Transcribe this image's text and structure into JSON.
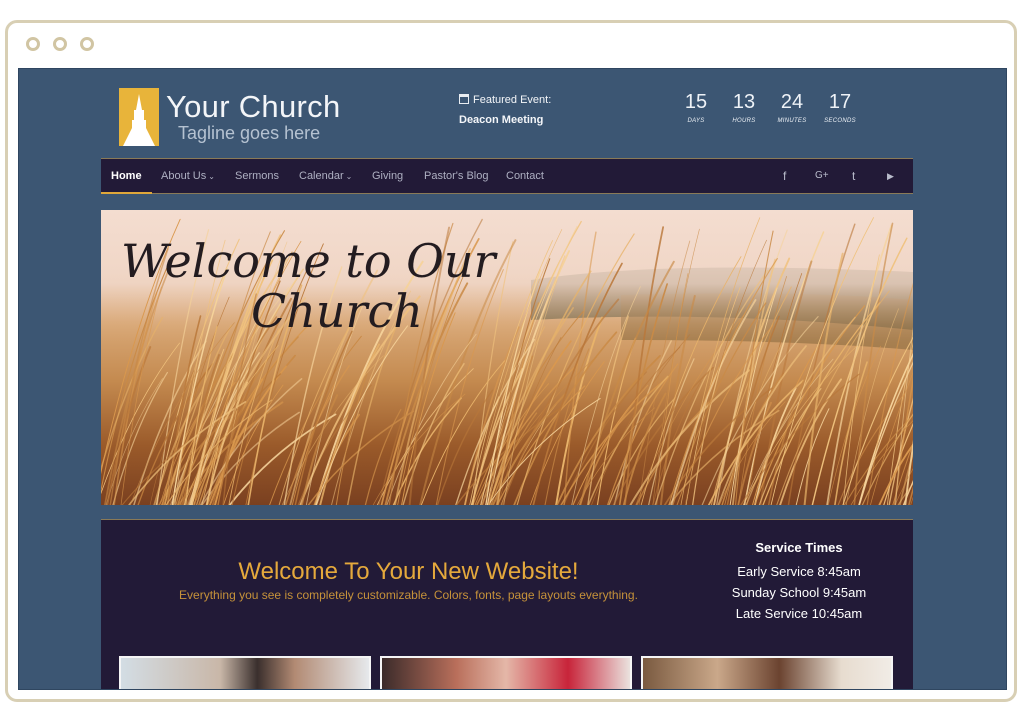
{
  "site": {
    "title": "Your Church",
    "tagline": "Tagline goes here"
  },
  "featured_event": {
    "label": "Featured Event:",
    "name": "Deacon Meeting"
  },
  "countdown": [
    {
      "value": "15",
      "label": "DAYS"
    },
    {
      "value": "13",
      "label": "HOURS"
    },
    {
      "value": "24",
      "label": "MINUTES"
    },
    {
      "value": "17",
      "label": "SECONDS"
    }
  ],
  "nav": {
    "items": [
      {
        "label": "Home",
        "active": true
      },
      {
        "label": "About Us",
        "dropdown": true
      },
      {
        "label": "Sermons"
      },
      {
        "label": "Calendar",
        "dropdown": true
      },
      {
        "label": "Giving"
      },
      {
        "label": "Pastor's Blog"
      },
      {
        "label": "Contact"
      }
    ],
    "social": [
      "facebook-icon",
      "google-plus-icon",
      "twitter-icon",
      "youtube-icon"
    ],
    "social_glyphs": [
      "f",
      "G+",
      "t",
      "▶"
    ]
  },
  "hero": {
    "line1": "Welcome to Our",
    "line2": "Church"
  },
  "welcome": {
    "title": "Welcome To Your New Website!",
    "subtitle": "Everything you see is completely customizable. Colors, fonts, page layouts everything."
  },
  "service_times": {
    "heading": "Service Times",
    "lines": [
      "Early Service 8:45am",
      "Sunday School 9:45am",
      "Late Service 10:45am"
    ]
  },
  "colors": {
    "page_bg": "#3c5673",
    "nav_bg": "#221a37",
    "accent": "#e5a93c",
    "logo": "#e8b43a"
  }
}
